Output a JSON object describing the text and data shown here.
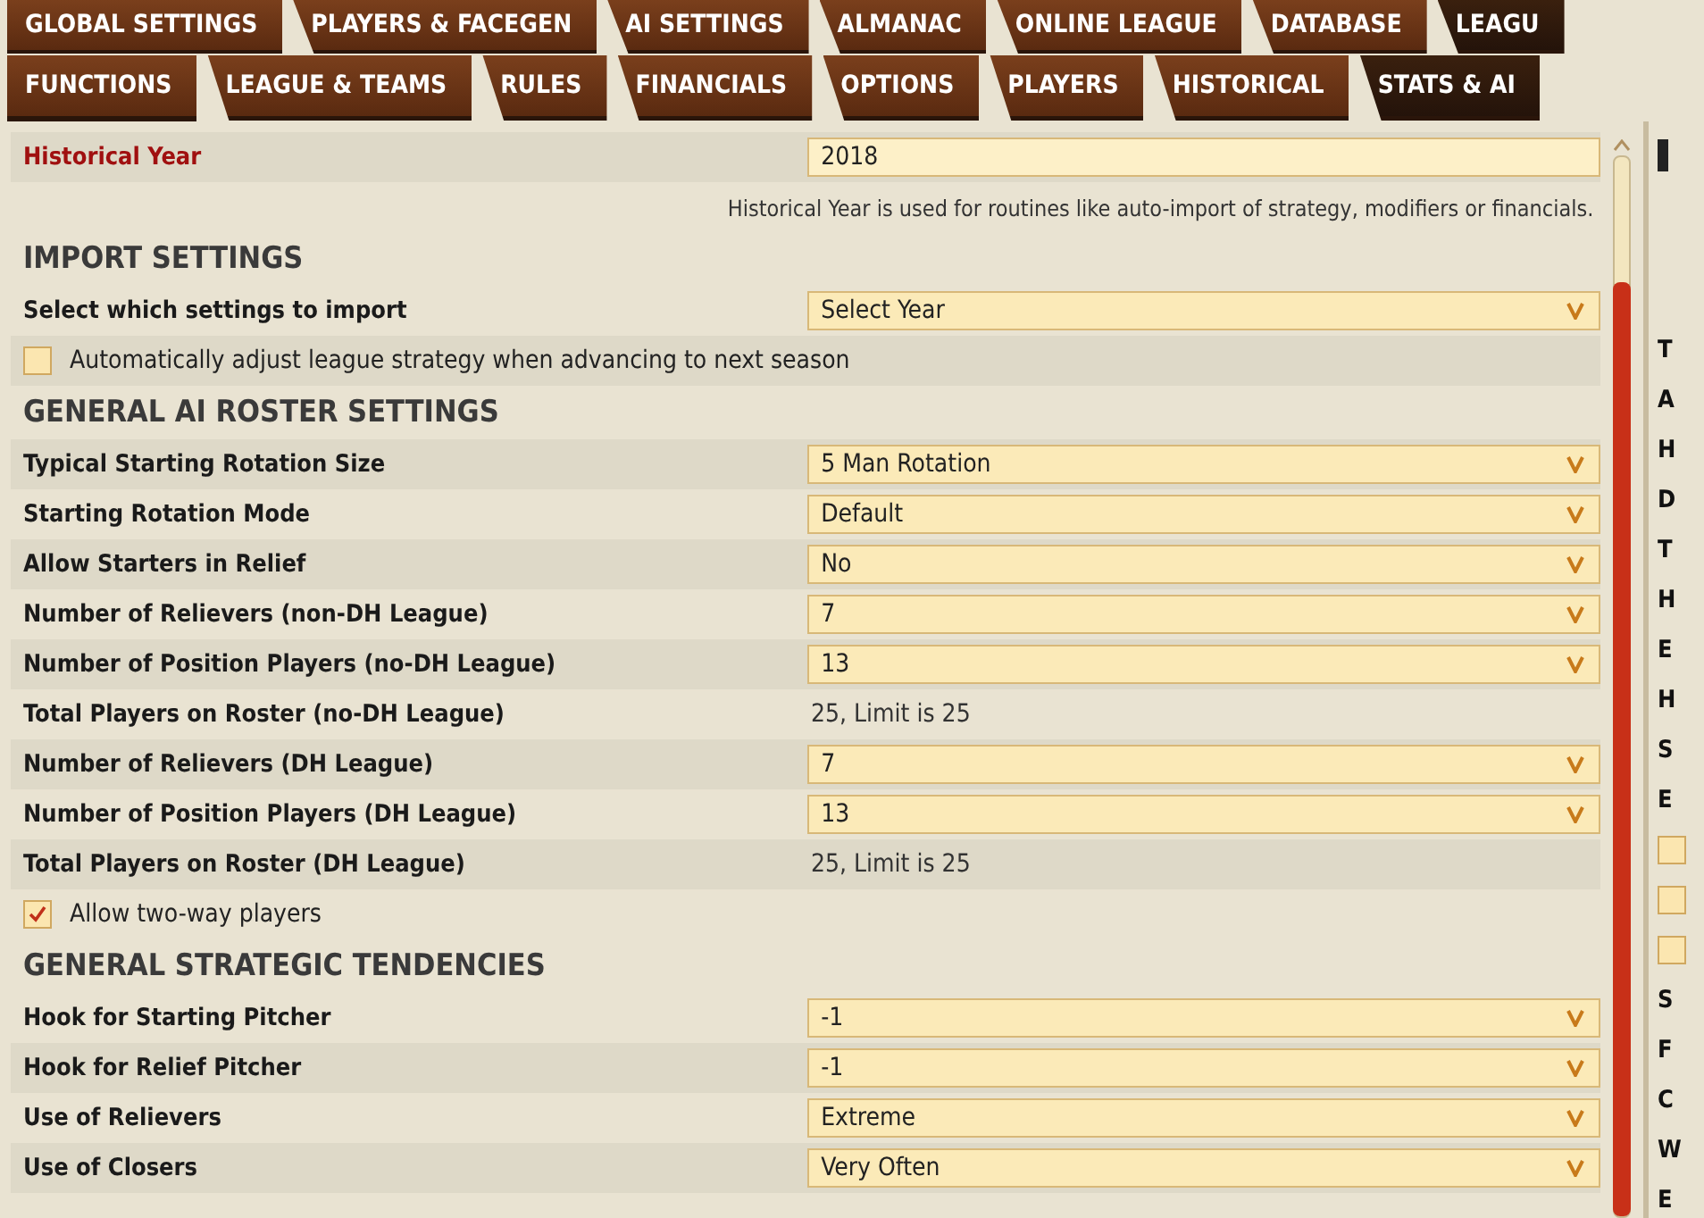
{
  "tabs_top": [
    {
      "label": "GLOBAL SETTINGS",
      "selected": false
    },
    {
      "label": "PLAYERS & FACEGEN",
      "selected": false
    },
    {
      "label": "AI SETTINGS",
      "selected": false
    },
    {
      "label": "ALMANAC",
      "selected": false
    },
    {
      "label": "ONLINE LEAGUE",
      "selected": false
    },
    {
      "label": "DATABASE",
      "selected": false
    },
    {
      "label": "LEAGU",
      "selected": true
    }
  ],
  "tabs_sub": [
    {
      "label": "FUNCTIONS",
      "selected": false
    },
    {
      "label": "LEAGUE & TEAMS",
      "selected": false
    },
    {
      "label": "RULES",
      "selected": false
    },
    {
      "label": "FINANCIALS",
      "selected": false
    },
    {
      "label": "OPTIONS",
      "selected": false
    },
    {
      "label": "PLAYERS",
      "selected": false
    },
    {
      "label": "HISTORICAL",
      "selected": false
    },
    {
      "label": "STATS & AI",
      "selected": true
    }
  ],
  "settings": [
    {
      "kind": "input",
      "label": "Historical Year",
      "value": "2018"
    },
    {
      "kind": "note",
      "text": "Historical Year is used for routines like auto-import of strategy, modifiers or financials."
    },
    {
      "kind": "heading",
      "text": "IMPORT SETTINGS"
    },
    {
      "kind": "dropdown",
      "label": "Select which settings to import",
      "value": "Select Year"
    },
    {
      "kind": "checkbox",
      "label": "Automatically adjust league strategy when advancing to next season",
      "checked": false
    },
    {
      "kind": "heading",
      "text": "GENERAL AI ROSTER SETTINGS"
    },
    {
      "kind": "dropdown",
      "label": "Typical Starting Rotation Size",
      "value": "5 Man Rotation"
    },
    {
      "kind": "dropdown",
      "label": "Starting Rotation Mode",
      "value": "Default"
    },
    {
      "kind": "dropdown",
      "label": "Allow Starters in Relief",
      "value": "No"
    },
    {
      "kind": "dropdown",
      "label": "Number of Relievers (non-DH League)",
      "value": "7"
    },
    {
      "kind": "dropdown",
      "label": "Number of Position Players (no-DH League)",
      "value": "13"
    },
    {
      "kind": "value",
      "label": "Total Players on Roster (no-DH League)",
      "value": "25, Limit is 25"
    },
    {
      "kind": "dropdown",
      "label": "Number of Relievers (DH League)",
      "value": "7"
    },
    {
      "kind": "dropdown",
      "label": "Number of Position Players (DH League)",
      "value": "13"
    },
    {
      "kind": "value",
      "label": "Total Players on Roster (DH League)",
      "value": "25, Limit is 25"
    },
    {
      "kind": "checkbox",
      "label": "Allow two-way players",
      "checked": true
    },
    {
      "kind": "heading",
      "text": "GENERAL STRATEGIC TENDENCIES"
    },
    {
      "kind": "dropdown",
      "label": "Hook for Starting Pitcher",
      "value": "-1"
    },
    {
      "kind": "dropdown",
      "label": "Hook for Relief Pitcher",
      "value": "-1"
    },
    {
      "kind": "dropdown",
      "label": "Use of Relievers",
      "value": "Extreme"
    },
    {
      "kind": "dropdown",
      "label": "Use of Closers",
      "value": "Very Often"
    }
  ],
  "side_panel": [
    {
      "kind": "text",
      "text": "T"
    },
    {
      "kind": "text",
      "text": "A"
    },
    {
      "kind": "text",
      "text": "H"
    },
    {
      "kind": "text",
      "text": "D"
    },
    {
      "kind": "text",
      "text": "T"
    },
    {
      "kind": "text",
      "text": "H"
    },
    {
      "kind": "text",
      "text": "E"
    },
    {
      "kind": "text",
      "text": "H"
    },
    {
      "kind": "text",
      "text": "S"
    },
    {
      "kind": "text",
      "text": "E"
    },
    {
      "kind": "checkbox",
      "checked": false
    },
    {
      "kind": "checkbox",
      "checked": false
    },
    {
      "kind": "checkbox",
      "checked": false
    },
    {
      "kind": "text",
      "text": "S"
    },
    {
      "kind": "text",
      "text": "F"
    },
    {
      "kind": "text",
      "text": "C"
    },
    {
      "kind": "text",
      "text": "W"
    },
    {
      "kind": "text",
      "text": "E"
    }
  ]
}
